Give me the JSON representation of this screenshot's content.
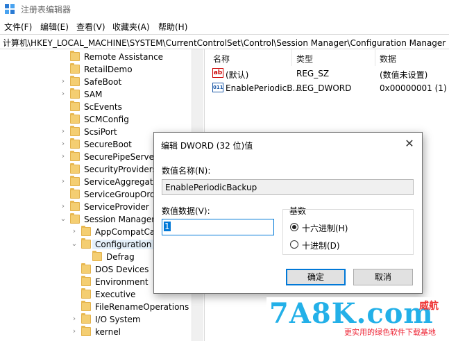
{
  "window": {
    "title": "注册表编辑器",
    "icon": "registry-editor-icon"
  },
  "menu": [
    "文件(F)",
    "编辑(E)",
    "查看(V)",
    "收藏夹(A)",
    "帮助(H)"
  ],
  "address": "计算机\\HKEY_LOCAL_MACHINE\\SYSTEM\\CurrentControlSet\\Control\\Session Manager\\Configuration Manager",
  "tree": [
    "Remote Assistance",
    "RetailDemo",
    "SafeBoot",
    "SAM",
    "ScEvents",
    "SCMConfig",
    "ScsiPort",
    "SecureBoot",
    "SecurePipeServers",
    "SecurityProviders",
    "ServiceAggregatedI",
    "ServiceGroupOrder",
    "ServiceProvider",
    "Session Manager",
    "AppCompatCac",
    "Configuration M",
    "Defrag",
    "DOS Devices",
    "Environment",
    "Executive",
    "FileRenameOperations",
    "I/O System",
    "kernel"
  ],
  "list": {
    "headers": {
      "name": "名称",
      "type": "类型",
      "data": "数据"
    },
    "rows": [
      {
        "name": "(默认)",
        "type": "REG_SZ",
        "data": "(数值未设置)",
        "icon": "string-value-icon",
        "glyph": "ab"
      },
      {
        "name": "EnablePeriodicB...",
        "type": "REG_DWORD",
        "data": "0x00000001 (1)",
        "icon": "dword-value-icon",
        "glyph": "011"
      }
    ]
  },
  "dialog": {
    "title": "编辑 DWORD (32 位)值",
    "close_glyph": "✕",
    "name_label": "数值名称(N):",
    "name_value": "EnablePeriodicBackup",
    "data_label": "数值数据(V):",
    "data_value": "1",
    "base_label": "基数",
    "base_options": [
      "十六进制(H)",
      "十进制(D)"
    ],
    "base_selected": "十六进制(H)",
    "ok_label": "确定",
    "cancel_label": "取消"
  },
  "watermark": {
    "logo": "7A8K.com",
    "brand": "威航",
    "slogan": "更实用的绿色软件下载基地"
  }
}
